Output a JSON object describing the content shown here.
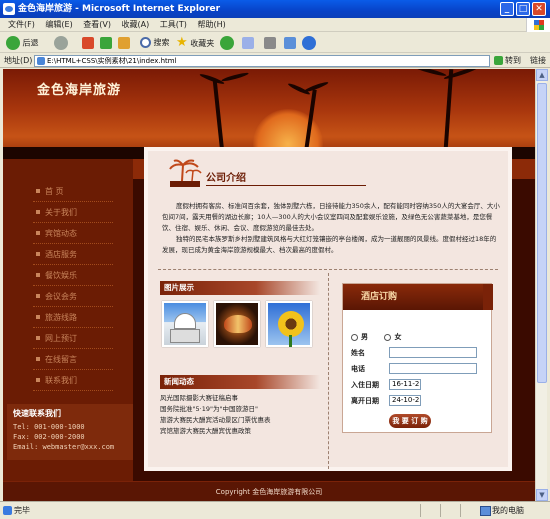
{
  "window": {
    "title": "金色海岸旅游 - Microsoft Internet Explorer",
    "min": "_",
    "max": "□",
    "close": "✕"
  },
  "menu": [
    "文件(F)",
    "编辑(E)",
    "查看(V)",
    "收藏(A)",
    "工具(T)",
    "帮助(H)"
  ],
  "toolbar": {
    "back": "后退",
    "search": "搜索",
    "favorites": "收藏夹"
  },
  "address": {
    "label": "地址(D)",
    "value": "E:\\HTML+CSS\\实例素材\\21\\index.html",
    "go": "转到",
    "links": "链接"
  },
  "site": {
    "title": "金色海岸旅游"
  },
  "nav": [
    "首 页",
    "关于我们",
    "宾馆动态",
    "酒店服务",
    "餐饮娱乐",
    "会议会务",
    "旅游线路",
    "网上预订",
    "在线留言",
    "联系我们"
  ],
  "contact": {
    "title": "快速联系我们",
    "tel": "Tel: 001-000-1000",
    "fax": "Fax: 002-000-2000",
    "email": "Email: webmaster@xxx.com"
  },
  "intro": {
    "title": "公司介绍",
    "p1": "度假村拥有客房、标准间百余套，独体别墅六栋，日接待能力350余人，配有能同时容纳350人的大宴会厅、大小包间7间，露天用餐的湖边长廊；10人—300人的大小会议室四间及配套娱乐设施，及绿色无公害蔬菜基地，是您餐饮、住宿、娱乐、休闲、会议、度假游览的最佳去处。",
    "p2": "独特的民宅本族罗斯乡村别墅建筑风格与大红灯笼镶嵌的亭台楼阁，成为一道靓丽的风景线。度假村经过18年的发展，现已成为黄金海岸旅游规模最大、档次最高的度假村。"
  },
  "photos": {
    "title": "图片展示"
  },
  "news": {
    "title": "新闻动态",
    "items": [
      "风光国际摄影大赛征稿启事",
      "国务院批准\"5·19\"为\"中国旅游日\"",
      "旅游大赛民大酬宾活动景区门票优惠表",
      "宾馆旅游大赛民大酬宾优惠政策"
    ]
  },
  "booking": {
    "title": "酒店订购",
    "male": "男",
    "female": "女",
    "name_label": "姓名",
    "phone_label": "电话",
    "checkin_label": "入住日期",
    "checkin_value": "16-11-2",
    "checkout_label": "离开日期",
    "checkout_value": "24-10-2",
    "submit": "我 要 订 购"
  },
  "footer": {
    "copyright": "Copyright 金色海岸旅游有限公司"
  },
  "status": {
    "left": "完毕",
    "right": "我的电脑"
  }
}
